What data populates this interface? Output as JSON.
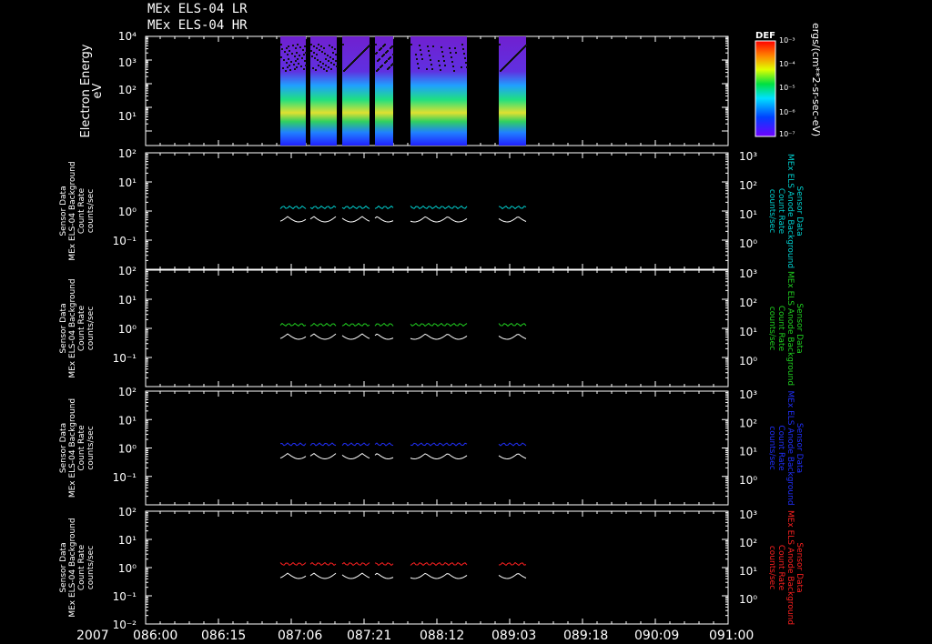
{
  "header": {
    "title_lines": [
      "MEx ELS-04 LR",
      "MEx ELS-04 HR"
    ]
  },
  "x_axis": {
    "year_label": "2007",
    "tick_labels": [
      "086:00",
      "086:15",
      "087:06",
      "087:21",
      "088:12",
      "089:03",
      "089:18",
      "090:09",
      "091:00"
    ]
  },
  "colorbar": {
    "title": "DEF",
    "tick_labels": [
      "10⁻⁴",
      "10⁻⁵",
      "10⁻⁶",
      "10⁻⁷"
    ],
    "top_label": "10⁻³",
    "units_label": "ergs/(cm**2-sr-sec-eV)"
  },
  "panels": [
    {
      "id": "spectrogram",
      "left_label": [
        "Electron Energy",
        "eV"
      ],
      "y_ticks": [
        "10⁴",
        "10³",
        "10²",
        "10¹"
      ]
    },
    {
      "id": "bg1",
      "left_label": [
        "Sensor Data",
        "MEx ELS-04 Background",
        "Count Rate",
        "counts/sec"
      ],
      "right_label": [
        "Sensor Data",
        "MEx ELS Anode Background",
        "Count Rate",
        "counts/sec"
      ],
      "right_color": "#00d0d0",
      "left_ticks": [
        "10²",
        "10¹",
        "10⁰",
        "10⁻¹"
      ],
      "right_ticks": [
        "10³",
        "10²",
        "10¹",
        "10⁰"
      ]
    },
    {
      "id": "bg2",
      "left_label": [
        "Sensor Data",
        "MEx ELS-04 Background",
        "Count Rate",
        "counts/sec"
      ],
      "right_label": [
        "Sensor Data",
        "MEx ELS Anode Background",
        "Count Rate",
        "counts/sec"
      ],
      "right_color": "#20d020",
      "left_ticks": [
        "10²",
        "10¹",
        "10⁰",
        "10⁻¹"
      ],
      "right_ticks": [
        "10³",
        "10²",
        "10¹",
        "10⁰"
      ]
    },
    {
      "id": "bg3",
      "left_label": [
        "Sensor Data",
        "MEx ELS-04 Background",
        "Count Rate",
        "counts/sec"
      ],
      "right_label": [
        "Sensor Data",
        "MEx ELS Anode Background",
        "Count Rate",
        "counts/sec"
      ],
      "right_color": "#2030ff",
      "left_ticks": [
        "10²",
        "10¹",
        "10⁰",
        "10⁻¹"
      ],
      "right_ticks": [
        "10³",
        "10²",
        "10¹",
        "10⁰"
      ]
    },
    {
      "id": "bg4",
      "left_label": [
        "Sensor Data",
        "MEx ELS-04 Background",
        "Count Rate",
        "counts/sec"
      ],
      "right_label": [
        "Sensor Data",
        "MEx ELS Anode Background",
        "Count Rate",
        "counts/sec"
      ],
      "right_color": "#ff2020",
      "left_ticks": [
        "10²",
        "10¹",
        "10⁰",
        "10⁻¹",
        "10⁻²"
      ],
      "right_ticks": [
        "10³",
        "10²",
        "10¹",
        "10⁰"
      ]
    }
  ],
  "chart_data": {
    "type": "line",
    "x_scale": "time (day:hour), 2007",
    "data_segments": [
      {
        "start": "086:53",
        "end": "087:03"
      },
      {
        "start": "087:06",
        "end": "087:14"
      },
      {
        "start": "087:17",
        "end": "087:28"
      },
      {
        "start": "088:02",
        "end": "088:09"
      },
      {
        "start": "088:12",
        "end": "088:30"
      },
      {
        "start": "089:03",
        "end": "089:09"
      }
    ],
    "spectrogram": {
      "ylim_eV": [
        1,
        10000
      ],
      "y_scale": "log",
      "colorbar_range": [
        1e-07,
        0.001
      ],
      "colormap": "rainbow (purple low, red high)"
    },
    "background_panels": {
      "left_ylim": [
        0.01,
        100
      ],
      "right_ylim": [
        1,
        1000
      ],
      "y_scale": "log",
      "series": [
        {
          "axis": "left",
          "color": "#ffffff",
          "typical_value": 0.7
        },
        {
          "axis": "right",
          "typical_value": 13
        }
      ]
    }
  }
}
